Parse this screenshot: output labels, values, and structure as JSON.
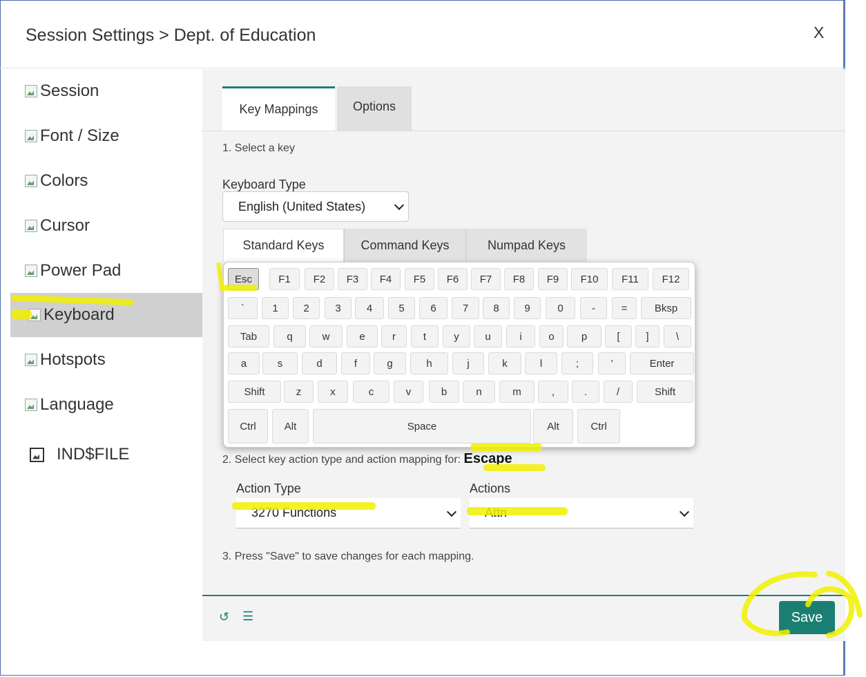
{
  "window": {
    "title": "Session Settings > Dept. of Education",
    "close_label": "X"
  },
  "sidebar": {
    "items": [
      {
        "label": "Session"
      },
      {
        "label": "Font / Size"
      },
      {
        "label": "Colors"
      },
      {
        "label": "Cursor"
      },
      {
        "label": "Power Pad"
      },
      {
        "label": "Keyboard",
        "active": true
      },
      {
        "label": "Hotspots"
      },
      {
        "label": "Language"
      },
      {
        "label": "IND$FILE"
      }
    ]
  },
  "tabs": {
    "key_mappings": "Key Mappings",
    "options": "Options"
  },
  "step1": "1. Select a key",
  "keyboard_type": {
    "label": "Keyboard Type",
    "value": "English (United States)"
  },
  "keyset_tabs": {
    "standard": "Standard Keys",
    "command": "Command Keys",
    "numpad": "Numpad Keys"
  },
  "keys": {
    "row1": [
      "Esc",
      "F1",
      "F2",
      "F3",
      "F4",
      "F5",
      "F6",
      "F7",
      "F8",
      "F9",
      "F10",
      "F11",
      "F12"
    ],
    "row2": [
      "`",
      "1",
      "2",
      "3",
      "4",
      "5",
      "6",
      "7",
      "8",
      "9",
      "0",
      "-",
      "=",
      "Bksp"
    ],
    "row3": [
      "Tab",
      "q",
      "w",
      "e",
      "r",
      "t",
      "y",
      "u",
      "i",
      "o",
      "p",
      "[",
      "]",
      "\\"
    ],
    "row4": [
      "a",
      "s",
      "d",
      "f",
      "g",
      "h",
      "j",
      "k",
      "l",
      ";",
      "'",
      "Enter"
    ],
    "row5": [
      "Shift",
      "z",
      "x",
      "c",
      "v",
      "b",
      "n",
      "m",
      ",",
      ".",
      "/",
      "Shift"
    ],
    "row6": [
      "Ctrl",
      "Alt",
      "Space",
      "Alt",
      "Ctrl"
    ]
  },
  "step2": {
    "prefix": "2. Select key action type and action mapping for:",
    "key_name": "Escape"
  },
  "action_type": {
    "label": "Action Type",
    "value": "3270 Functions"
  },
  "actions": {
    "label": "Actions",
    "value": "Attn"
  },
  "step3": "3. Press \"Save\" to save changes for each mapping.",
  "footer": {
    "save_label": "Save",
    "reset_icon": "↺",
    "list_icon": "☰"
  },
  "colors": {
    "accent": "#1a7f72",
    "highlight": "#f0f000"
  }
}
